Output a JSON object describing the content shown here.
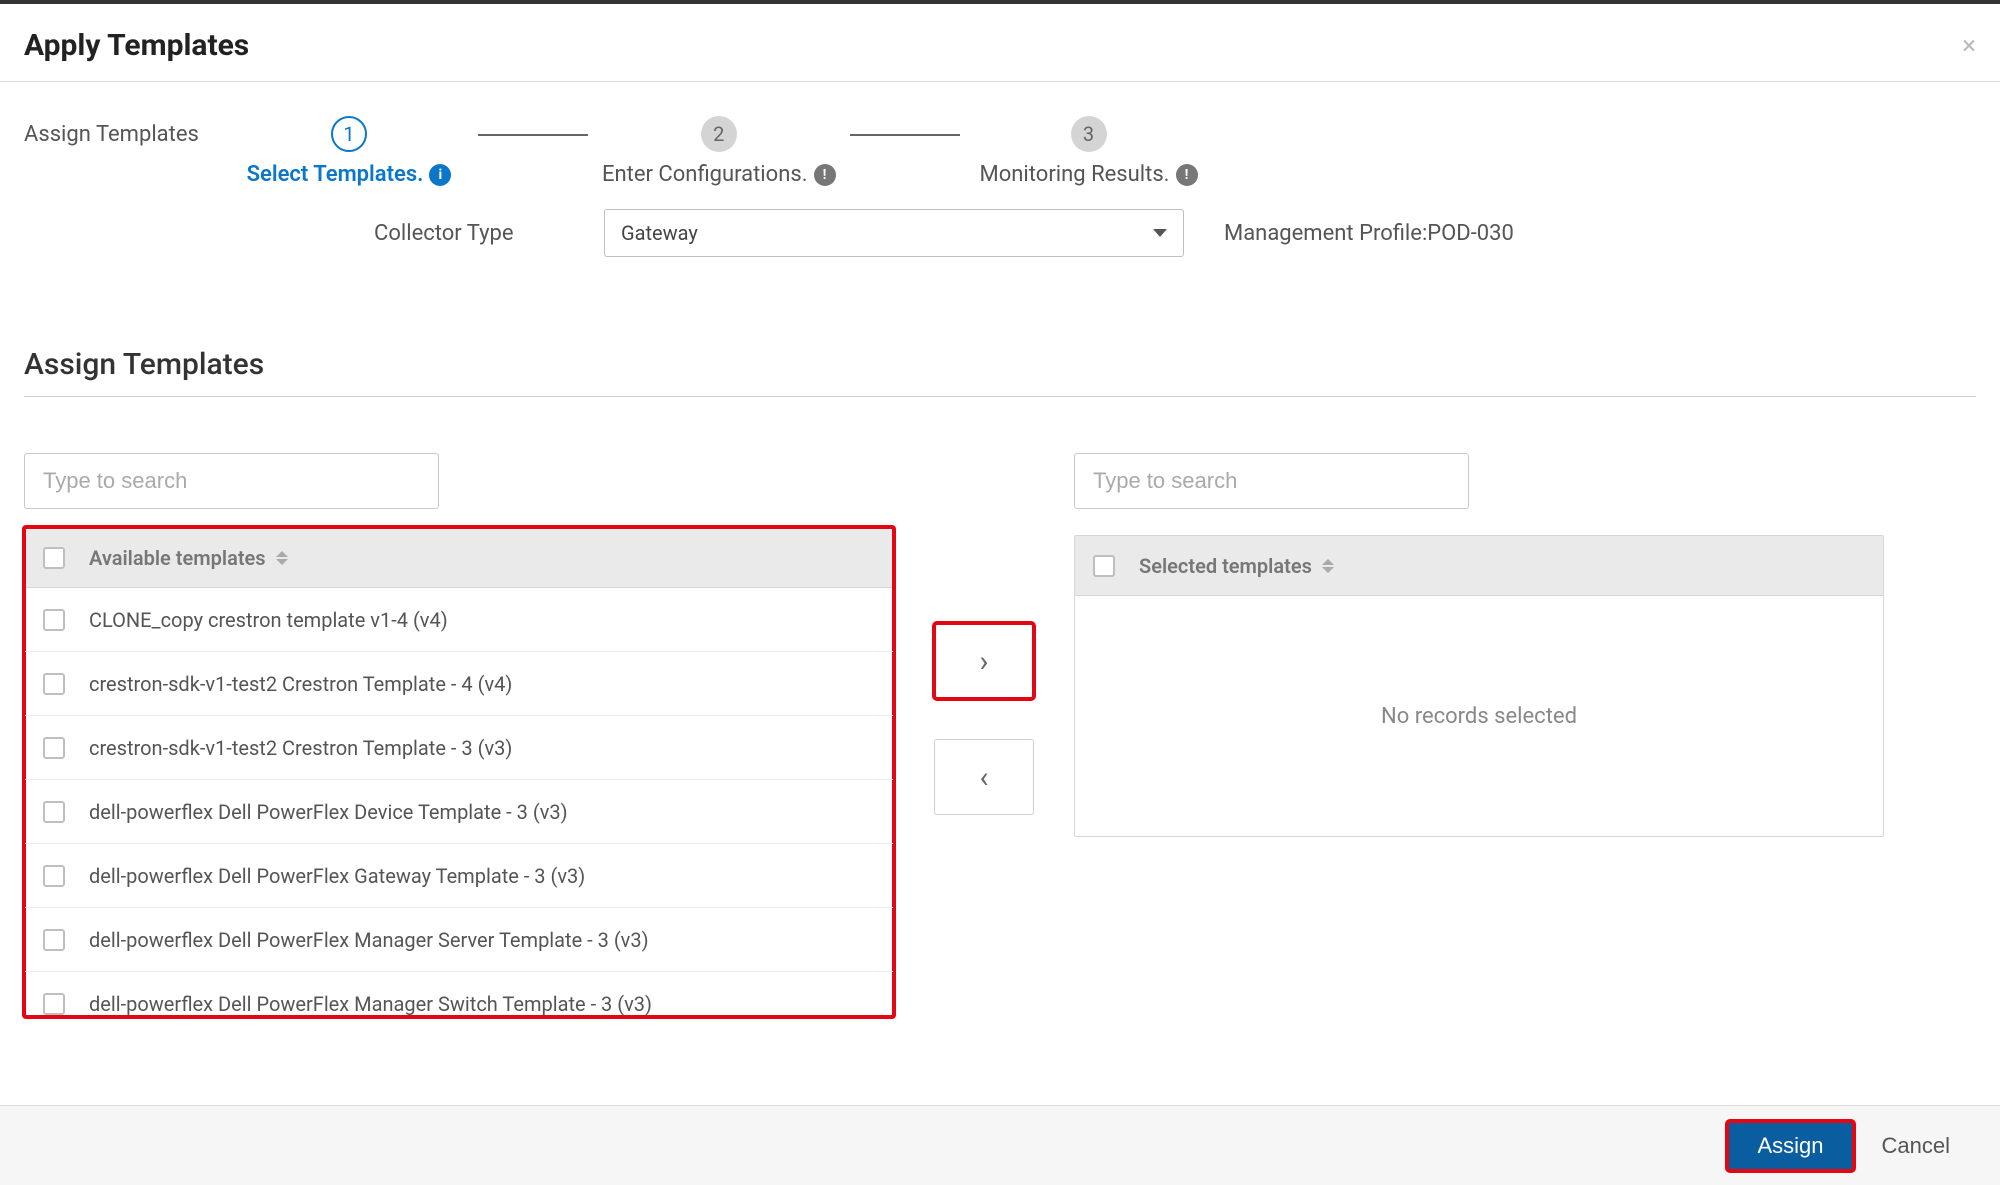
{
  "modal": {
    "title": "Apply Templates"
  },
  "wizard": {
    "label": "Assign Templates",
    "steps": [
      {
        "num": "1",
        "label": "Select Templates."
      },
      {
        "num": "2",
        "label": "Enter Configurations."
      },
      {
        "num": "3",
        "label": "Monitoring Results."
      }
    ]
  },
  "collector": {
    "label": "Collector Type",
    "value": "Gateway",
    "profile": "Management Profile:POD-030"
  },
  "section": {
    "title": "Assign Templates"
  },
  "available": {
    "search_placeholder": "Type to search",
    "header": "Available templates",
    "rows": [
      "CLONE_copy crestron template v1-4 (v4)",
      "crestron-sdk-v1-test2 Crestron Template - 4 (v4)",
      "crestron-sdk-v1-test2 Crestron Template - 3 (v3)",
      "dell-powerflex Dell PowerFlex Device Template - 3 (v3)",
      "dell-powerflex Dell PowerFlex Gateway Template - 3 (v3)",
      "dell-powerflex Dell PowerFlex Manager Server Template - 3 (v3)",
      "dell-powerflex Dell PowerFlex Manager Switch Template - 3 (v3)"
    ]
  },
  "selected": {
    "search_placeholder": "Type to search",
    "header": "Selected templates",
    "empty": "No records selected"
  },
  "footer": {
    "assign": "Assign",
    "cancel": "Cancel"
  }
}
